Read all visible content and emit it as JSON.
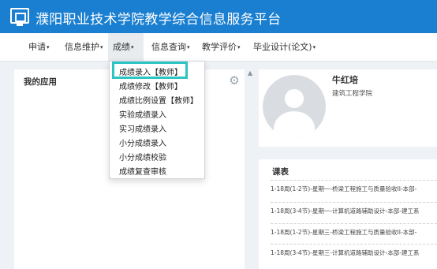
{
  "header": {
    "title": "濮阳职业技术学院教学综合信息服务平台"
  },
  "nav": {
    "items": [
      {
        "label": "申请",
        "caret": "▾"
      },
      {
        "label": "信息维护",
        "caret": "▾"
      },
      {
        "label": "成绩",
        "caret": "▾"
      },
      {
        "label": "信息查询",
        "caret": "▾"
      },
      {
        "label": "教学评价",
        "caret": "▾"
      },
      {
        "label": "毕业设计(论文)",
        "caret": "▾"
      }
    ]
  },
  "dropdown": {
    "items": [
      "成绩录入【教师】",
      "成绩修改【教师】",
      "成绩比例设置【教师】",
      "实验成绩录入",
      "实习成绩录入",
      "小分成绩录入",
      "小分成绩校验",
      "成绩复查审核"
    ]
  },
  "apps": {
    "title": "我的应用",
    "settings_icon": "gear-icon"
  },
  "profile": {
    "name": "牛红培",
    "department": "建筑工程学院"
  },
  "schedule": {
    "title": "课表",
    "rows": [
      "1-18周(1-2节)-星期一-桥梁工程施工与质量验收II-本部-",
      "1-18周(3-4节)-星期一-计算机道路辅助设计-本部-建工系",
      "1-18周(1-2节)-星期三-桥梁工程施工与质量验收II-本部-",
      "1-18周(3-4节)-星期三-计算机道路辅助设计-本部-建工系"
    ]
  }
}
